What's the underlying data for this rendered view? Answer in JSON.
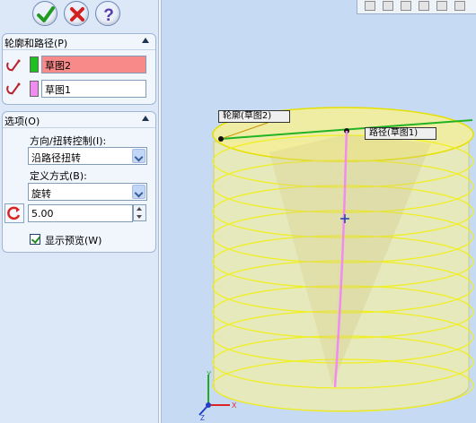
{
  "buttons": {
    "ok_icon": "check-icon",
    "cancel_icon": "x-icon",
    "help_icon": "question-icon"
  },
  "profile_path": {
    "title": "轮廓和路径(P)",
    "profile_value": "草图2",
    "path_value": "草图1",
    "profile_color": "#20c020",
    "path_color": "#f08cf0",
    "active_color": "#f98a8a"
  },
  "options": {
    "title": "选项(O)",
    "orientation_label": "方向/扭转控制(I):",
    "orientation_value": "沿路径扭转",
    "define_label": "定义方式(B):",
    "define_value": "旋转",
    "spin_value": "5.00",
    "preview_label": "显示预览(W)",
    "preview_checked": true
  },
  "viewport": {
    "callout_profile": "轮廓(草图2)",
    "callout_path": "路径(草图1)",
    "axis_x": "X",
    "axis_y": "Y",
    "axis_z": "Z"
  }
}
